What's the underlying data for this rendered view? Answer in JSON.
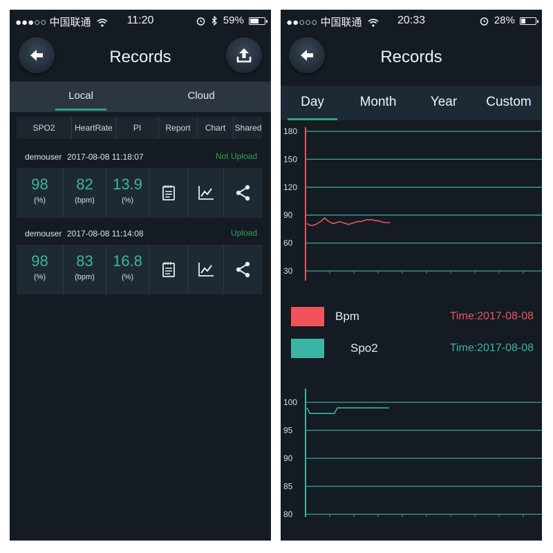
{
  "left": {
    "status": {
      "signal": "●●●○○",
      "carrier": "中国联通",
      "time": "11:20",
      "battery": "59%",
      "battery_level": 0.59
    },
    "header": {
      "title": "Records"
    },
    "tabs": [
      {
        "label": "Local",
        "active": true
      },
      {
        "label": "Cloud",
        "active": false
      }
    ],
    "columns": [
      "SPO2",
      "HeartRate",
      "PI",
      "Report",
      "Chart",
      "Shared"
    ],
    "records": [
      {
        "user": "demouser",
        "datetime": "2017-08-08 11:18:07",
        "status": "Not Upload",
        "spo2": "98",
        "spo2_unit": "(%)",
        "hr": "82",
        "hr_unit": "(bpm)",
        "pi": "13.9",
        "pi_unit": "(%)"
      },
      {
        "user": "demouser",
        "datetime": "2017-08-08 11:14:08",
        "status": "Upload",
        "spo2": "98",
        "spo2_unit": "(%)",
        "hr": "83",
        "hr_unit": "(bpm)",
        "pi": "16.8",
        "pi_unit": "(%)"
      }
    ]
  },
  "right": {
    "status": {
      "signal": "●●○○○",
      "carrier": "中国联通",
      "time": "20:33",
      "battery": "28%",
      "battery_level": 0.28
    },
    "header": {
      "title": "Records"
    },
    "tabs": [
      {
        "label": "Day",
        "active": true
      },
      {
        "label": "Month",
        "active": false
      },
      {
        "label": "Year",
        "active": false
      },
      {
        "label": "Custom",
        "active": false
      }
    ],
    "legend": [
      {
        "name": "Bpm",
        "time": "Time:2017-08-08",
        "color": "#f0545a"
      },
      {
        "name": "Spo2",
        "time": "Time:2017-08-08",
        "color": "#3ab5a5"
      }
    ]
  },
  "colors": {
    "accent": "#2ea37a",
    "teal": "#3fb5a5",
    "red": "#f0545a",
    "bg": "#141b23",
    "upload_green": "#35a152"
  },
  "chart_data": [
    {
      "type": "line",
      "title": "",
      "series": [
        {
          "name": "Bpm",
          "color": "#f0545a",
          "values": [
            81,
            79,
            79,
            80,
            82,
            84,
            87,
            84,
            82,
            81,
            82,
            83,
            82,
            81,
            80,
            81,
            82,
            83,
            83,
            84,
            85,
            85,
            85,
            84,
            84,
            83,
            82,
            82,
            82
          ]
        }
      ],
      "yticks": [
        180,
        150,
        120,
        90,
        60,
        30
      ],
      "ylim": [
        30,
        180
      ],
      "grid": true,
      "xlabel": "",
      "ylabel": ""
    },
    {
      "type": "line",
      "title": "",
      "series": [
        {
          "name": "Spo2",
          "color": "#3ab5a5",
          "values": [
            99,
            98,
            98,
            98,
            98,
            98,
            98,
            98,
            98,
            98,
            99,
            99,
            99,
            99,
            99,
            99,
            99,
            99,
            99,
            99,
            99,
            99,
            99,
            99,
            99,
            99,
            99,
            99
          ]
        }
      ],
      "yticks": [
        100,
        95,
        90,
        85,
        80
      ],
      "ylim": [
        80,
        100
      ],
      "grid": true,
      "xlabel": "",
      "ylabel": ""
    }
  ]
}
